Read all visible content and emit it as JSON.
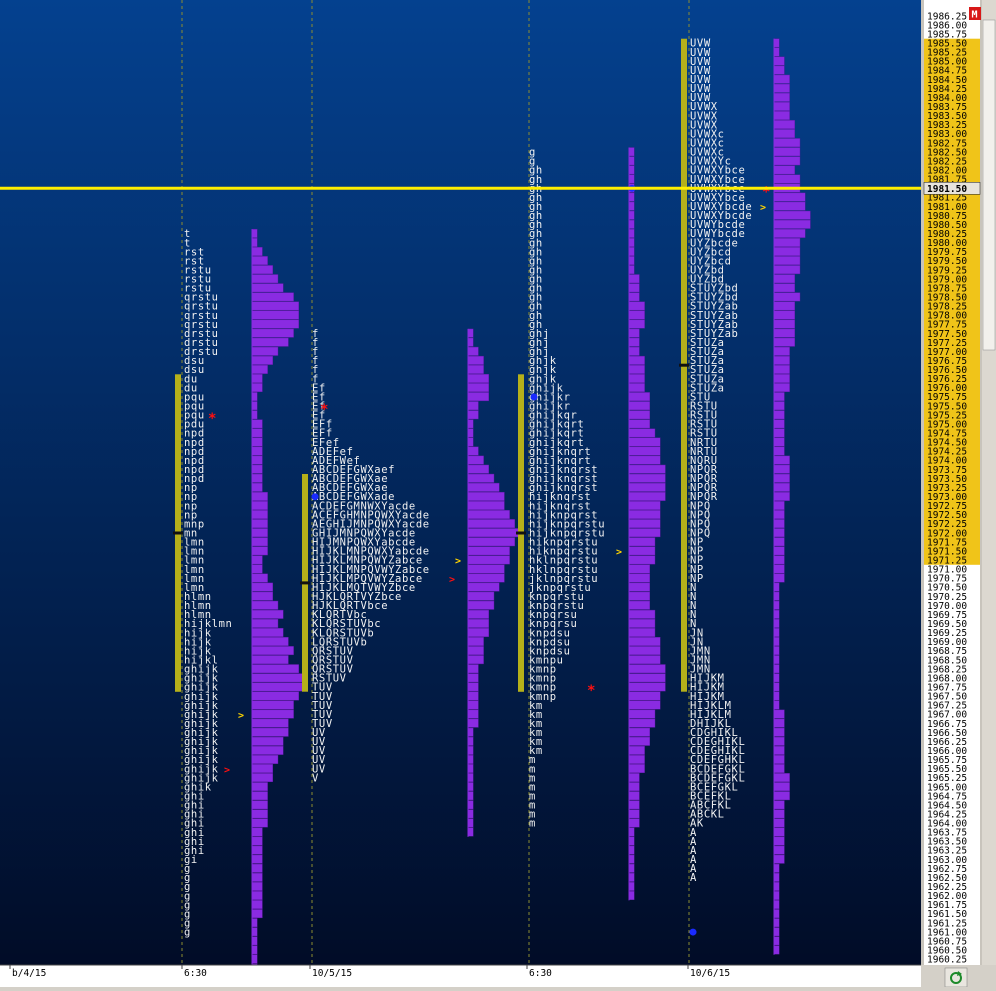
{
  "window": {
    "badge_label": "M",
    "refresh_icon": "refresh-icon"
  },
  "colors": {
    "background_top": "#04418f",
    "background_bottom": "#010c27",
    "letters": "#f2f2f2",
    "histogram": "#8a2be2",
    "value_area": "#b5b01a",
    "price_line": "#ffee00",
    "axis_bg": "#ffffff",
    "axis_highlight": "#f0c419",
    "grid": "#8c8c30",
    "poor_marker": "#ff1010",
    "extension_marker": "#ffd400",
    "open_marker": "#1a2aff"
  },
  "chart_data": {
    "type": "market_profile",
    "y_axis": {
      "min": 1960.0,
      "max": 1986.25,
      "tick_step": 0.25,
      "value_area_highlight": [
        1971.25,
        1985.5
      ],
      "current_price": "1981.50"
    },
    "x_axis": {
      "tick_labels": [
        "b/4/15",
        "6:30",
        "10/5/15",
        "6:30",
        "10/6/15"
      ]
    },
    "sessions": [
      {
        "letters_top": 1980.25,
        "rows": [
          "t",
          "t",
          "rst",
          "rst",
          "rstu",
          "rstu",
          "rstu",
          "qrstu",
          "qrstu",
          "qrstu",
          "qrstu",
          "drstu",
          "drstu",
          "drstu",
          "dsu",
          "dsu",
          "du",
          "du",
          "pqu",
          "pqu",
          "pqu",
          "pdu",
          "npd",
          "npd",
          "npd",
          "npd",
          "npd",
          "npd",
          "np",
          "np",
          "np",
          "np",
          "mnp",
          "mn",
          "lmn",
          "lmn",
          "lmn",
          "lmn",
          "lmn",
          "lmn",
          "hlmn",
          "hlmn",
          "hlmn",
          "hijklmn",
          "hijk",
          "hijk",
          "hijk",
          "hijkl",
          "ghijk",
          "ghijk",
          "ghijk",
          "ghijk",
          "ghijk",
          "ghijk",
          "ghijk",
          "ghijk",
          "ghijk",
          "ghijk",
          "ghijk",
          "ghijk",
          "ghijk",
          "ghik",
          "ghi",
          "ghi",
          "ghi",
          "ghi",
          "ghi",
          "ghi",
          "ghi",
          "gi",
          "g",
          "g",
          "g",
          "g",
          "g",
          "g",
          "g",
          "g"
        ],
        "value_area": [
          1967.75,
          1976.25
        ],
        "histogram_top": 1980.25,
        "histogram": [
          1,
          1,
          2,
          3,
          4,
          5,
          6,
          8,
          9,
          9,
          9,
          8,
          7,
          5,
          4,
          3,
          2,
          2,
          1,
          1,
          1,
          2,
          2,
          2,
          2,
          2,
          2,
          2,
          2,
          3,
          3,
          3,
          3,
          3,
          3,
          3,
          2,
          2,
          3,
          4,
          4,
          5,
          6,
          5,
          6,
          7,
          8,
          7,
          9,
          10,
          10,
          9,
          8,
          8,
          7,
          7,
          6,
          6,
          5,
          4,
          4,
          3,
          3,
          3,
          3,
          3,
          2,
          2,
          2,
          2,
          2,
          2,
          2,
          2,
          2,
          2,
          1,
          1,
          1,
          1,
          1,
          1,
          1,
          1
        ]
      },
      {
        "letters_top": 1977.5,
        "rows": [
          "f",
          "f",
          "f",
          "f",
          "f",
          "f",
          "Ef",
          "Ef",
          "Ef",
          "Ef",
          "EFf",
          "EFf",
          "EFef",
          "ADEFef",
          "ADEFWef",
          "ABCDEFGWXaef",
          "ABCDEFGWXae",
          "ABCDEFGWXae",
          "ABCDEFGWXade",
          "ACDEFGMNWXYacde",
          "ACEFGHMNPQWXYacde",
          "AEGHIJMNPQWXYacde",
          "GHIJMNPQWXYacde",
          "HIJMNPQWXYabcde",
          "HIJKLMNPQWXYabcde",
          "HIJKLMNPQWYZabce",
          "HIJKLMNPQVWYZabce",
          "HIJKLMPQVWYZabce",
          "HIJKLMQTVWYZbce",
          "HJKLQRTVYZbce",
          "HJKLQRTVbce",
          "KLQRTVbc",
          "KLQRSTUVbc",
          "KLQRSTUVb",
          "LQRSTUVb",
          "QRSTUV",
          "QRSTUV",
          "QRSTUV",
          "RSTUV",
          "TUV",
          "TUV",
          "TUV",
          "TUV",
          "TUV",
          "UV",
          "UV",
          "UV",
          "UV",
          "UV",
          "V"
        ],
        "value_area": [
          1967.75,
          1973.5
        ],
        "histogram_top": 1977.5,
        "histogram": [
          1,
          1,
          2,
          3,
          3,
          4,
          4,
          4,
          2,
          2,
          1,
          1,
          1,
          2,
          3,
          4,
          5,
          6,
          7,
          7,
          8,
          9,
          10,
          9,
          8,
          8,
          7,
          7,
          6,
          5,
          5,
          4,
          4,
          4,
          3,
          3,
          3,
          2,
          2,
          2,
          2,
          2,
          2,
          2,
          1,
          1,
          1,
          1,
          1,
          1,
          1,
          1,
          1,
          1,
          1,
          1
        ]
      },
      {
        "letters_top": 1982.5,
        "rows": [
          "g",
          "g",
          "gh",
          "gh",
          "gh",
          "gh",
          "gh",
          "gh",
          "gh",
          "gh",
          "gh",
          "gh",
          "gh",
          "gh",
          "gh",
          "gh",
          "gh",
          "gh",
          "gh",
          "gh",
          "ghj",
          "ghj",
          "ghj",
          "ghjk",
          "ghjk",
          "ghjk",
          "ghijk",
          "ghijkr",
          "ghijkr",
          "ghijkqr",
          "ghijkqrt",
          "ghijkqrt",
          "ghijkqrt",
          "ghijknqrt",
          "ghijknqrt",
          "ghijknqrst",
          "ghijknqrst",
          "ghijknqrst",
          "hijknqrst",
          "hijknqrst",
          "hijknpqrst",
          "hijknpqrstu",
          "hijknpqrstu",
          "hiknpqrstu",
          "hiknpqrstu",
          "hklnpqrstu",
          "hklnpqrstu",
          "jklnpqrstu",
          "jknpqrstu",
          "knpqrstu",
          "knpqrstu",
          "knpqrsu",
          "knpqrsu",
          "knpdsu",
          "knpdsu",
          "knpdsu",
          "kmnpu",
          "kmnp",
          "kmnp",
          "kmnp",
          "kmnp",
          "km",
          "km",
          "km",
          "km",
          "km",
          "km",
          "m",
          "m",
          "m",
          "m",
          "m",
          "m",
          "m",
          "m"
        ],
        "value_area": [
          1967.75,
          1976.25
        ],
        "histogram_top": 1982.5,
        "histogram": [
          1,
          1,
          1,
          1,
          1,
          1,
          1,
          1,
          1,
          1,
          1,
          1,
          1,
          1,
          2,
          2,
          2,
          3,
          3,
          3,
          2,
          2,
          2,
          3,
          3,
          3,
          3,
          4,
          4,
          4,
          4,
          5,
          6,
          6,
          6,
          7,
          7,
          7,
          7,
          6,
          6,
          6,
          6,
          5,
          5,
          5,
          4,
          4,
          4,
          4,
          4,
          5,
          5,
          5,
          6,
          6,
          6,
          7,
          7,
          7,
          6,
          6,
          5,
          5,
          4,
          4,
          3,
          3,
          3,
          2,
          2,
          2,
          2,
          2,
          2,
          1,
          1,
          1,
          1,
          1,
          1,
          1,
          1
        ]
      },
      {
        "letters_top": 1985.5,
        "rows": [
          "UVW",
          "UVW",
          "UVW",
          "UVW",
          "UVW",
          "UVW",
          "UVW",
          "UVWX",
          "UVWX",
          "UVWX",
          "UVWXc",
          "UVWXc",
          "UVWXc",
          "UVWXYc",
          "UVWXYbce",
          "UVWXYbce",
          "UVWXYbce",
          "UVWXYbce",
          "UVWXYbcde",
          "UVWXYbcde",
          "UVWYbcde",
          "UVWYbcde",
          "UYZbcde",
          "UYZbcd",
          "UYZbcd",
          "UYZbd",
          "UYZbd",
          "STUYZbd",
          "STUYZbd",
          "STUYZab",
          "STUYZab",
          "STUYZab",
          "STUYZab",
          "STUZa",
          "STUZa",
          "STUZa",
          "STUZa",
          "STUZa",
          "STUZa",
          "STU",
          "RSTU",
          "RSTU",
          "RSTU",
          "RSTU",
          "NRTU",
          "NRTU",
          "NQRU",
          "NPQR",
          "NPQR",
          "NPQR",
          "NPQR",
          "NPQ",
          "NPQ",
          "NPQ",
          "NPQ",
          "NP",
          "NP",
          "NP",
          "NP",
          "NP",
          "N",
          "N",
          "N",
          "N",
          "N",
          "JN",
          "JN",
          "JMN",
          "JMN",
          "JMN",
          "HIJKM",
          "HIJKM",
          "HIJKM",
          "HIJKLM",
          "HIJKLM",
          "DHIJKL",
          "CDGHIKL",
          "CDEGHIKL",
          "CDEGHIKL",
          "CDEFGHKL",
          "BCDEFGKL",
          "BCDEFGKL",
          "BCEFGKL",
          "BCEFKL",
          "ABCFKL",
          "ABCKL",
          "AK",
          "A",
          "A",
          "A",
          "A",
          "A",
          "A"
        ],
        "value_area": [
          1967.75,
          1985.5
        ],
        "histogram_top": 1985.5,
        "histogram": [
          1,
          1,
          2,
          2,
          3,
          3,
          3,
          3,
          3,
          4,
          4,
          5,
          5,
          5,
          4,
          5,
          5,
          6,
          6,
          7,
          7,
          6,
          5,
          5,
          5,
          5,
          4,
          4,
          5,
          4,
          4,
          4,
          4,
          4,
          3,
          3,
          3,
          3,
          3,
          2,
          2,
          2,
          2,
          2,
          2,
          2,
          3,
          3,
          3,
          3,
          3,
          2,
          2,
          2,
          2,
          2,
          2,
          2,
          2,
          2,
          1,
          1,
          1,
          1,
          1,
          1,
          1,
          1,
          1,
          1,
          1,
          1,
          1,
          1,
          2,
          2,
          2,
          2,
          2,
          2,
          2,
          3,
          3,
          3,
          2,
          2,
          2,
          2,
          2,
          2,
          2,
          1,
          1,
          1,
          1,
          1,
          1,
          1,
          1,
          1,
          1
        ]
      }
    ]
  }
}
